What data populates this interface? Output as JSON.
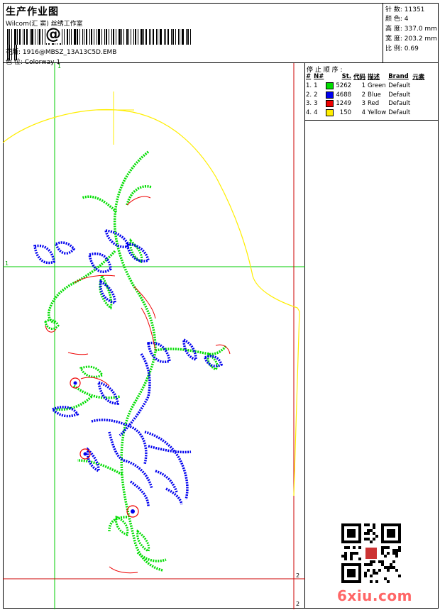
{
  "header": {
    "title": "生产作业图",
    "studio": "Wilcom(汇 窦) 丝绣工作室",
    "design_label": "花版:",
    "design_file": "1916@MBSZ_13A13C5D.EMB",
    "colorway_label": "色 位:",
    "colorway": "Colorway 1",
    "barcode_glyph": "@"
  },
  "stats": [
    {
      "label": "针 数:",
      "value": "11351"
    },
    {
      "label": "颜 色:",
      "value": "4"
    },
    {
      "label": "高 度:",
      "value": "337.0 mm"
    },
    {
      "label": "宽 度:",
      "value": "203.2 mm"
    },
    {
      "label": "比 例:",
      "value": "0.69"
    }
  ],
  "stop_sequence": {
    "title": "停 止 顺 序 :",
    "columns": [
      "#",
      "N#",
      "St.",
      "代码",
      "描述",
      "Brand",
      "元素"
    ],
    "rows": [
      {
        "idx": "1.",
        "n": "1",
        "color": "#00dd00",
        "st": "5262",
        "code": "1",
        "desc": "Green",
        "brand": "Default"
      },
      {
        "idx": "2.",
        "n": "2",
        "color": "#0000ee",
        "st": "4688",
        "code": "2",
        "desc": "Blue",
        "brand": "Default"
      },
      {
        "idx": "3.",
        "n": "3",
        "color": "#ee0000",
        "st": "1249",
        "code": "3",
        "desc": "Red",
        "brand": "Default"
      },
      {
        "idx": "4.",
        "n": "4",
        "color": "#ffee00",
        "st": "150",
        "code": "4",
        "desc": "Yellow",
        "brand": "Default"
      }
    ]
  },
  "guides": {
    "vertical_1": "1",
    "horizontal_1": "1",
    "vertical_2": "2",
    "horizontal_2": "2"
  },
  "watermark": "6xiu.com",
  "colors": {
    "green_thread": "#00dd00",
    "blue_thread": "#0000ee",
    "red_thread": "#ee0000",
    "yellow_thread": "#ffee00",
    "guide_green": "#00cc00",
    "guide_red": "#cc0000"
  }
}
